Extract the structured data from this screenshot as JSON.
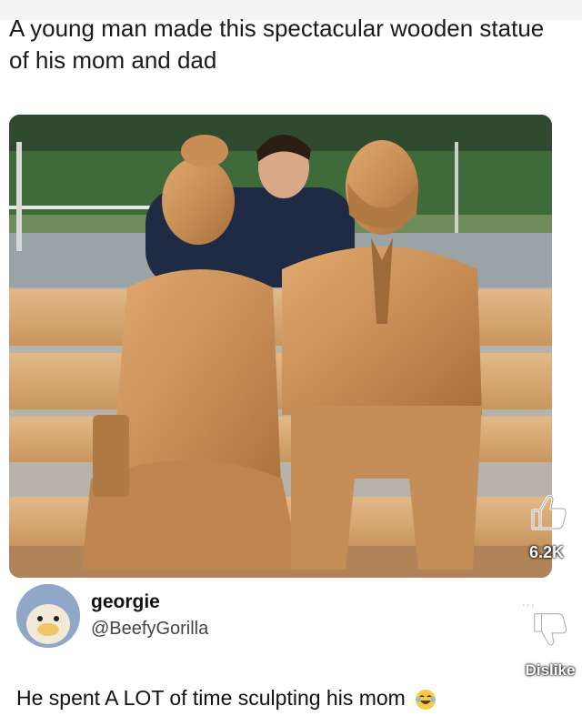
{
  "post": {
    "caption": "A young man made this spectacular wooden statue of his mom and dad"
  },
  "image": {
    "subject": "photo-wooden-statue-couple-on-bench"
  },
  "author": {
    "name": "georgie",
    "handle": "@BeefyGorilla"
  },
  "reply": {
    "text": "He spent A LOT of time sculpting his mom",
    "emoji": "laughing-face-icon"
  },
  "actions": {
    "like_count": "6.2K",
    "more": "...",
    "dislike_label": "Dislike"
  },
  "icons": {
    "like": "thumbs-up-icon",
    "dislike": "thumbs-down-icon"
  },
  "colors": {
    "wood": "#c88e55",
    "text": "#111111"
  }
}
